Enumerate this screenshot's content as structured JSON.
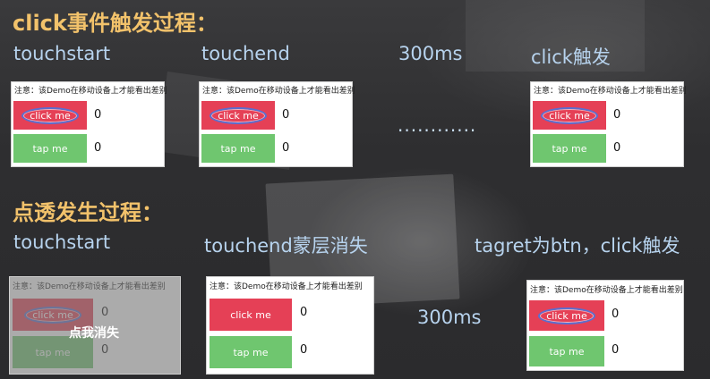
{
  "section1": {
    "heading": "click事件触发过程：",
    "stages": [
      "touchstart",
      "touchend",
      "300ms",
      "click触发"
    ],
    "ellipsis": "............"
  },
  "section2": {
    "heading": "点透发生过程：",
    "stages": [
      "touchstart",
      "touchend蒙层消失",
      "tagret为btn，click触发"
    ],
    "delay_label": "300ms",
    "overlay_label": "点我消失"
  },
  "demo": {
    "note": "注意：该Demo在移动设备上才能看出差别",
    "click_label": "click me",
    "tap_label": "tap me",
    "click_count": "0",
    "tap_count": "0"
  },
  "colors": {
    "heading": "#f2c26b",
    "stage_text": "#b7d3ee",
    "click_button": "#e54056",
    "tap_button": "#6fc66f",
    "highlight_circle": "#5a6fd0"
  }
}
